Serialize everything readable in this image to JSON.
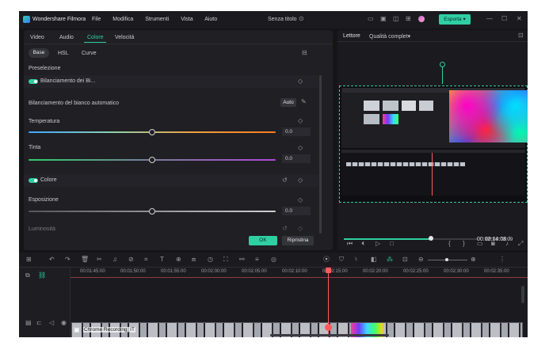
{
  "app": {
    "name": "Wondershare Filmora",
    "menu": [
      "File",
      "Modifica",
      "Strumenti",
      "Vista",
      "Aiuto"
    ],
    "project_title": "Senza titolo",
    "export_label": "Esporta"
  },
  "editor": {
    "tabs": [
      "Video",
      "Audio",
      "Colore",
      "Velocità"
    ],
    "active_tab": "Colore",
    "subtabs": [
      "Base",
      "HSL",
      "Curve"
    ],
    "active_subtab": "Base",
    "preset_label": "Preselezione",
    "white_balance_label": "Bilanciamento dei Bi...",
    "auto_wb_label": "Bilanciamento del bianco automatico",
    "auto_button": "Auto",
    "temperature_label": "Temperatura",
    "temperature_value": "0.0",
    "tint_label": "Tinta",
    "tint_value": "0.0",
    "color_label": "Colore",
    "exposure_label": "Esposizione",
    "exposure_value": "0.0",
    "brightness_label": "Luminosità",
    "ok_button": "OK",
    "reset_button": "Ripristina"
  },
  "preview": {
    "player_label": "Lettore",
    "quality_label": "Qualità complet",
    "current_time": "00:02:14:08",
    "separator": "/",
    "total_time": "00:03:03:09",
    "progress": 0.65
  },
  "timeline": {
    "ruler": [
      "00:01:45:00",
      "00:01:50:00",
      "00:01:55:00",
      "00:02:00:00",
      "00:02:05:00",
      "00:02:10:00",
      "00:02:15:00",
      "00:02:20:00",
      "00:02:25:00",
      "00:02:30:00",
      "00:02:35:00"
    ],
    "clip_label": "Chrome Recording_IT"
  },
  "colors": {
    "accent": "#2fcfa3",
    "playhead": "#ff5a5a"
  }
}
